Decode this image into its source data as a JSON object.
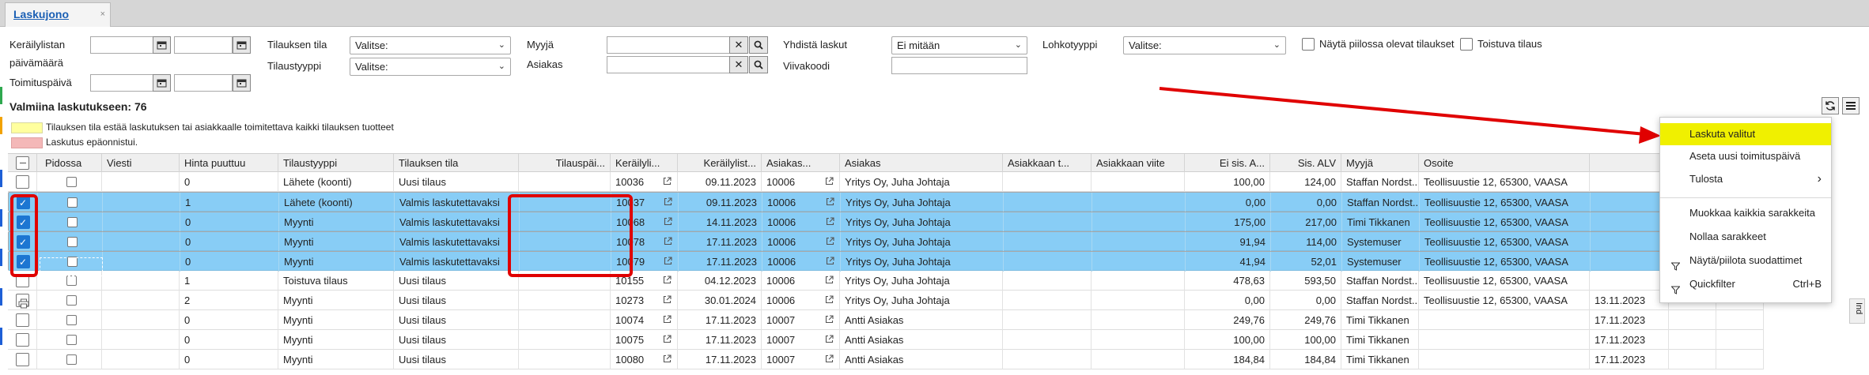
{
  "tab": {
    "title": "Laskujono",
    "close": "×"
  },
  "filters": {
    "keraily_date_label": "Keräilylistan",
    "keraily_date_label2": "päivämäärä",
    "toimitus_date_label": "Toimituspäivä",
    "tilauksen_tila_label": "Tilauksen tila",
    "tilaustyyppi_label": "Tilaustyyppi",
    "select_placeholder": "Valitse:",
    "myyja_label": "Myyjä",
    "asiakas_label": "Asiakas",
    "yhdista_label": "Yhdistä laskut",
    "yhdista_value": "Ei mitään",
    "viivakoodi_label": "Viivakoodi",
    "lohkotyyppi_label": "Lohkotyyppi",
    "nayta_pilossa_label": "Näytä piilossa olevat tilaukset",
    "toistuva_label": "Toistuva tilaus"
  },
  "summary": "Valmiina laskutukseen: 76",
  "legend": {
    "yellow_text": "Tilauksen tila estää laskutuksen tai asiakkaalle toimitettava kaikki tilauksen tuotteet",
    "pink_text": "Laskutus epäonnistui.",
    "yellow_color": "#ffff9e",
    "pink_color": "#f4b8b8"
  },
  "colors": {
    "selected_row": "#88cdf6",
    "accent": "#1c76d2",
    "highlight": "#e00000",
    "menu_highlight": "#f0f000"
  },
  "grid": {
    "headers": [
      "Pidossa",
      "Viesti",
      "Hinta puuttuu",
      "Tilaustyyppi",
      "Tilauksen tila",
      "Tilauspäi...",
      "Keräilyli...",
      "Keräilylist...",
      "Asiakas...",
      "Asiakas",
      "Asiakkaan t...",
      "Asiakkaan viite",
      "Ei sis. A...",
      "Sis. ALV",
      "Myyjä",
      "Osoite",
      "",
      "",
      ""
    ],
    "rows": [
      {
        "checked": false,
        "selected": false,
        "print": false,
        "hinta": "0",
        "tyyppi": "Lähete (koonti)",
        "tila": "Uusi tilaus",
        "keraily_no": "10036",
        "keraily_pvm": "09.11.2023",
        "asiakasnro": "10006",
        "asiakas": "Yritys Oy, Juha Johtaja",
        "ei_sis": "100,00",
        "sis_alv": "124,00",
        "myyja": "Staffan Nordst...",
        "osoite": "Teollisuustie 12, 65300, VAASA",
        "pvm2": ""
      },
      {
        "checked": true,
        "selected": true,
        "print": false,
        "hinta": "1",
        "tyyppi": "Lähete (koonti)",
        "tila": "Valmis laskutettavaksi",
        "keraily_no": "10037",
        "keraily_pvm": "09.11.2023",
        "asiakasnro": "10006",
        "asiakas": "Yritys Oy, Juha Johtaja",
        "ei_sis": "0,00",
        "sis_alv": "0,00",
        "myyja": "Staffan Nordst...",
        "osoite": "Teollisuustie 12, 65300, VAASA",
        "pvm2": ""
      },
      {
        "checked": true,
        "selected": true,
        "print": false,
        "hinta": "0",
        "tyyppi": "Myynti",
        "tila": "Valmis laskutettavaksi",
        "keraily_no": "10068",
        "keraily_pvm": "14.11.2023",
        "asiakasnro": "10006",
        "asiakas": "Yritys Oy, Juha Johtaja",
        "ei_sis": "175,00",
        "sis_alv": "217,00",
        "myyja": "Timi Tikkanen",
        "osoite": "Teollisuustie 12, 65300, VAASA",
        "pvm2": ""
      },
      {
        "checked": true,
        "selected": true,
        "print": false,
        "hinta": "0",
        "tyyppi": "Myynti",
        "tila": "Valmis laskutettavaksi",
        "keraily_no": "10078",
        "keraily_pvm": "17.11.2023",
        "asiakasnro": "10006",
        "asiakas": "Yritys Oy, Juha Johtaja",
        "ei_sis": "91,94",
        "sis_alv": "114,00",
        "myyja": "Systemuser",
        "osoite": "Teollisuustie 12, 65300, VAASA",
        "pvm2": ""
      },
      {
        "checked": true,
        "selected": true,
        "print": false,
        "hinta": "0",
        "tyyppi": "Myynti",
        "tila": "Valmis laskutettavaksi",
        "keraily_no": "10079",
        "keraily_pvm": "17.11.2023",
        "asiakasnro": "10006",
        "asiakas": "Yritys Oy, Juha Johtaja",
        "ei_sis": "41,94",
        "sis_alv": "52,01",
        "myyja": "Systemuser",
        "osoite": "Teollisuustie 12, 65300, VAASA",
        "pvm2": ""
      },
      {
        "checked": false,
        "selected": false,
        "print": false,
        "hinta": "1",
        "tyyppi": "Toistuva tilaus",
        "tila": "Uusi tilaus",
        "keraily_no": "10155",
        "keraily_pvm": "04.12.2023",
        "asiakasnro": "10006",
        "asiakas": "Yritys Oy, Juha Johtaja",
        "ei_sis": "478,63",
        "sis_alv": "593,50",
        "myyja": "Staffan Nordst...",
        "osoite": "Teollisuustie 12, 65300, VAASA",
        "pvm2": ""
      },
      {
        "checked": false,
        "selected": false,
        "print": true,
        "hinta": "2",
        "tyyppi": "Myynti",
        "tila": "Uusi tilaus",
        "keraily_no": "10273",
        "keraily_pvm": "30.01.2024",
        "asiakasnro": "10006",
        "asiakas": "Yritys Oy, Juha Johtaja",
        "ei_sis": "0,00",
        "sis_alv": "0,00",
        "myyja": "Staffan Nordst...",
        "osoite": "Teollisuustie 12, 65300, VAASA",
        "pvm2": "13.11.2023"
      },
      {
        "checked": false,
        "selected": false,
        "print": false,
        "hinta": "0",
        "tyyppi": "Myynti",
        "tila": "Uusi tilaus",
        "keraily_no": "10074",
        "keraily_pvm": "17.11.2023",
        "asiakasnro": "10007",
        "asiakas": "Antti Asiakas",
        "ei_sis": "249,76",
        "sis_alv": "249,76",
        "myyja": "Timi Tikkanen",
        "osoite": "",
        "pvm2": "17.11.2023"
      },
      {
        "checked": false,
        "selected": false,
        "print": false,
        "hinta": "0",
        "tyyppi": "Myynti",
        "tila": "Uusi tilaus",
        "keraily_no": "10075",
        "keraily_pvm": "17.11.2023",
        "asiakasnro": "10007",
        "asiakas": "Antti Asiakas",
        "ei_sis": "100,00",
        "sis_alv": "100,00",
        "myyja": "Timi Tikkanen",
        "osoite": "",
        "pvm2": "17.11.2023"
      },
      {
        "checked": false,
        "selected": false,
        "print": false,
        "hinta": "0",
        "tyyppi": "Myynti",
        "tila": "Uusi tilaus",
        "keraily_no": "10080",
        "keraily_pvm": "17.11.2023",
        "asiakasnro": "10007",
        "asiakas": "Antti Asiakas",
        "ei_sis": "184,84",
        "sis_alv": "184,84",
        "myyja": "Timi Tikkanen",
        "osoite": "",
        "pvm2": "17.11.2023"
      }
    ]
  },
  "menu": {
    "items": [
      {
        "label": "Laskuta valitut",
        "shortcut": "",
        "highlight": true
      },
      {
        "label": "Aseta uusi toimituspäivä",
        "shortcut": ""
      },
      {
        "label": "Tulosta",
        "shortcut": "›"
      },
      {
        "label": "Muokkaa kaikkia sarakkeita",
        "shortcut": ""
      },
      {
        "label": "Nollaa sarakkeet",
        "shortcut": ""
      },
      {
        "label": "Näytä/piilota suodattimet",
        "shortcut": ""
      },
      {
        "label": "Quickfilter",
        "shortcut": "Ctrl+B"
      }
    ]
  },
  "side_tab": "Ind"
}
